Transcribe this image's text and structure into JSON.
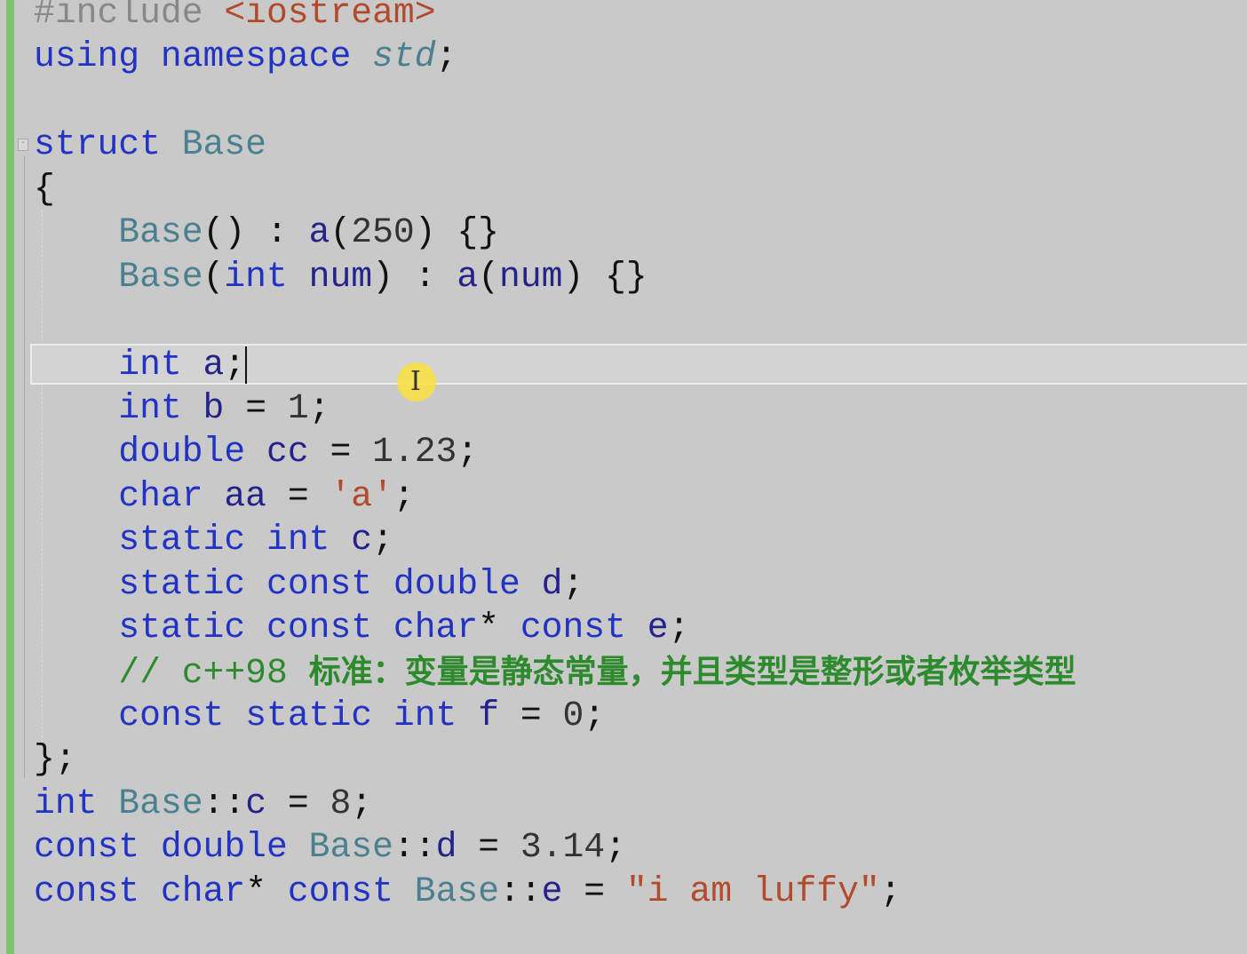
{
  "editor": {
    "cursor_icon": "text-ibeam-icon",
    "fold_symbol": "-",
    "lines": [
      [
        [
          "#include ",
          "pp"
        ],
        [
          "<iostream>",
          "str"
        ]
      ],
      [
        [
          "using",
          "kw"
        ],
        [
          " ",
          "pun"
        ],
        [
          "namespace",
          "kw"
        ],
        [
          " ",
          "pun"
        ],
        [
          "std",
          "ns"
        ],
        [
          ";",
          "pun"
        ]
      ],
      [],
      [
        [
          "struct",
          "kw"
        ],
        [
          " ",
          "pun"
        ],
        [
          "Base",
          "ty"
        ]
      ],
      [
        [
          "{",
          "pun"
        ]
      ],
      [
        [
          "    ",
          "pun"
        ],
        [
          "Base",
          "ty"
        ],
        [
          "() : ",
          "pun"
        ],
        [
          "a",
          "var"
        ],
        [
          "(",
          "pun"
        ],
        [
          "250",
          "num"
        ],
        [
          ") {}",
          "pun"
        ]
      ],
      [
        [
          "    ",
          "pun"
        ],
        [
          "Base",
          "ty"
        ],
        [
          "(",
          "pun"
        ],
        [
          "int",
          "kw"
        ],
        [
          " ",
          "pun"
        ],
        [
          "num",
          "var"
        ],
        [
          ") : ",
          "pun"
        ],
        [
          "a",
          "var"
        ],
        [
          "(",
          "pun"
        ],
        [
          "num",
          "var"
        ],
        [
          ") {}",
          "pun"
        ]
      ],
      [],
      [
        [
          "    ",
          "pun"
        ],
        [
          "int",
          "kw"
        ],
        [
          " ",
          "pun"
        ],
        [
          "a",
          "var"
        ],
        [
          ";",
          "pun"
        ]
      ],
      [
        [
          "    ",
          "pun"
        ],
        [
          "int",
          "kw"
        ],
        [
          " ",
          "pun"
        ],
        [
          "b",
          "var"
        ],
        [
          " = ",
          "pun"
        ],
        [
          "1",
          "num"
        ],
        [
          ";",
          "pun"
        ]
      ],
      [
        [
          "    ",
          "pun"
        ],
        [
          "double",
          "kw"
        ],
        [
          " ",
          "pun"
        ],
        [
          "cc",
          "var"
        ],
        [
          " = ",
          "pun"
        ],
        [
          "1.23",
          "num"
        ],
        [
          ";",
          "pun"
        ]
      ],
      [
        [
          "    ",
          "pun"
        ],
        [
          "char",
          "kw"
        ],
        [
          " ",
          "pun"
        ],
        [
          "aa",
          "var"
        ],
        [
          " = ",
          "pun"
        ],
        [
          "'a'",
          "str"
        ],
        [
          ";",
          "pun"
        ]
      ],
      [
        [
          "    ",
          "pun"
        ],
        [
          "static",
          "kw"
        ],
        [
          " ",
          "pun"
        ],
        [
          "int",
          "kw"
        ],
        [
          " ",
          "pun"
        ],
        [
          "c",
          "var"
        ],
        [
          ";",
          "pun"
        ]
      ],
      [
        [
          "    ",
          "pun"
        ],
        [
          "static",
          "kw"
        ],
        [
          " ",
          "pun"
        ],
        [
          "const",
          "kw"
        ],
        [
          " ",
          "pun"
        ],
        [
          "double",
          "kw"
        ],
        [
          " ",
          "pun"
        ],
        [
          "d",
          "var"
        ],
        [
          ";",
          "pun"
        ]
      ],
      [
        [
          "    ",
          "pun"
        ],
        [
          "static",
          "kw"
        ],
        [
          " ",
          "pun"
        ],
        [
          "const",
          "kw"
        ],
        [
          " ",
          "pun"
        ],
        [
          "char",
          "kw"
        ],
        [
          "* ",
          "pun"
        ],
        [
          "const",
          "kw"
        ],
        [
          " ",
          "pun"
        ],
        [
          "e",
          "var"
        ],
        [
          ";",
          "pun"
        ]
      ],
      [
        [
          "    ",
          "pun"
        ],
        [
          "// c++98 ",
          "cm"
        ],
        [
          "标准：变量是静态常量，并且类型是整形或者枚举类型",
          "cjk"
        ]
      ],
      [
        [
          "    ",
          "pun"
        ],
        [
          "const",
          "kw"
        ],
        [
          " ",
          "pun"
        ],
        [
          "static",
          "kw"
        ],
        [
          " ",
          "pun"
        ],
        [
          "int",
          "kw"
        ],
        [
          " ",
          "pun"
        ],
        [
          "f",
          "var"
        ],
        [
          " = ",
          "pun"
        ],
        [
          "0",
          "num"
        ],
        [
          ";",
          "pun"
        ]
      ],
      [
        [
          "};",
          "pun"
        ]
      ],
      [
        [
          "int",
          "kw"
        ],
        [
          " ",
          "pun"
        ],
        [
          "Base",
          "ty"
        ],
        [
          "::",
          "pun"
        ],
        [
          "c",
          "var"
        ],
        [
          " = ",
          "pun"
        ],
        [
          "8",
          "num"
        ],
        [
          ";",
          "pun"
        ]
      ],
      [
        [
          "const",
          "kw"
        ],
        [
          " ",
          "pun"
        ],
        [
          "double",
          "kw"
        ],
        [
          " ",
          "pun"
        ],
        [
          "Base",
          "ty"
        ],
        [
          "::",
          "pun"
        ],
        [
          "d",
          "var"
        ],
        [
          " = ",
          "pun"
        ],
        [
          "3.14",
          "num"
        ],
        [
          ";",
          "pun"
        ]
      ],
      [
        [
          "const",
          "kw"
        ],
        [
          " ",
          "pun"
        ],
        [
          "char",
          "kw"
        ],
        [
          "* ",
          "pun"
        ],
        [
          "const",
          "kw"
        ],
        [
          " ",
          "pun"
        ],
        [
          "Base",
          "ty"
        ],
        [
          "::",
          "pun"
        ],
        [
          "e",
          "var"
        ],
        [
          " = ",
          "pun"
        ],
        [
          "\"i am luffy\"",
          "str"
        ],
        [
          ";",
          "pun"
        ]
      ]
    ]
  }
}
